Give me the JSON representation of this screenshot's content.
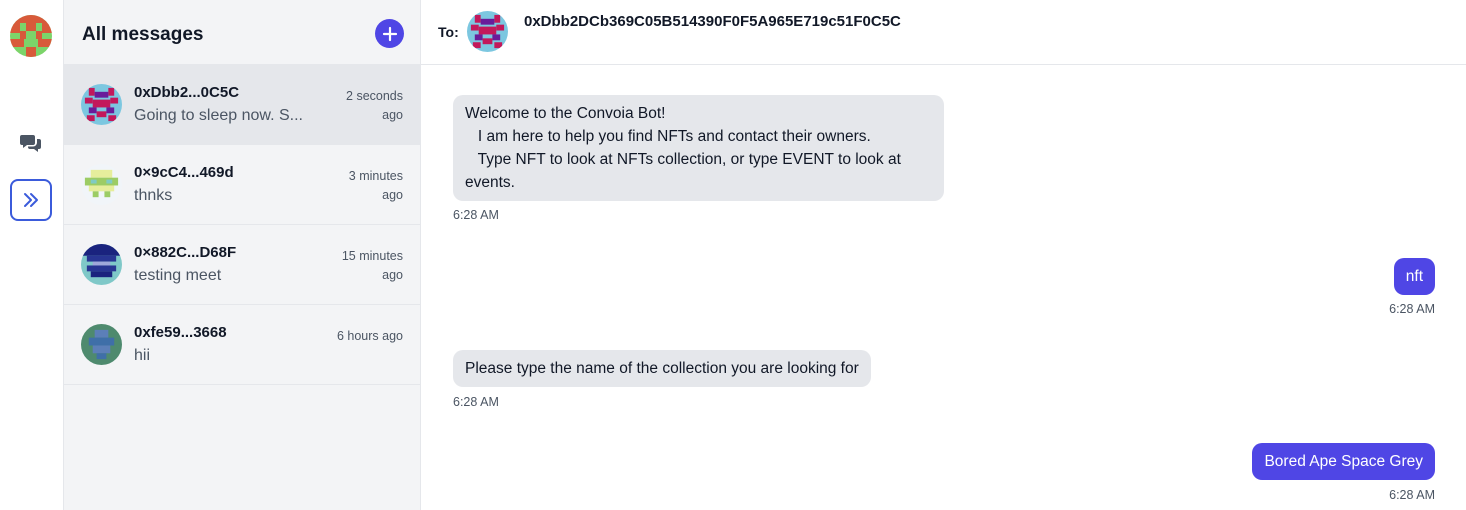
{
  "sidebar": {
    "chats_icon": "chat-bubbles-icon",
    "expand_icon": "double-chevron-right-icon"
  },
  "list": {
    "title": "All messages",
    "new_icon": "plus-icon",
    "conversations": [
      {
        "name": "0xDbb2...0C5C",
        "preview": "Going to sleep now. S...",
        "time": "2 seconds ago",
        "active": true
      },
      {
        "name": "0×9cC4...469d",
        "preview": "thnks",
        "time": "3 minutes ago",
        "active": false
      },
      {
        "name": "0×882C...D68F",
        "preview": "testing meet",
        "time": "15 minutes ago",
        "active": false
      },
      {
        "name": "0xfe59...3668",
        "preview": "hii",
        "time": "6 hours ago",
        "active": false
      }
    ]
  },
  "chat": {
    "to_label": "To:",
    "address": "0xDbb2DCb369C05B514390F0F5A965E719c51F0C5C",
    "messages": [
      {
        "direction": "in",
        "lines": [
          "Welcome to the Convoia Bot!",
          "   I am here to help you find NFTs and contact their owners.",
          "   Type NFT to look at NFTs collection, or type EVENT to look at",
          "events."
        ],
        "time": "6:28 AM"
      },
      {
        "direction": "out",
        "lines": [
          "nft"
        ],
        "time": "6:28 AM"
      },
      {
        "direction": "in",
        "lines": [
          "Please type the name of the collection you are looking for"
        ],
        "time": "6:28 AM"
      },
      {
        "direction": "out",
        "lines": [
          "Bored Ape Space Grey"
        ],
        "time": "6:28 AM"
      }
    ]
  },
  "colors": {
    "accent": "#4f46e5",
    "incoming_bubble": "#e5e7eb",
    "list_background": "#f3f4f6"
  }
}
